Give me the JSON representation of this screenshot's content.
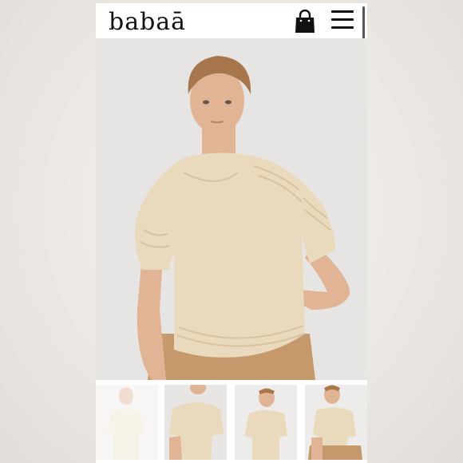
{
  "header": {
    "logo_text": "babaā",
    "bag_icon": "shopping-bag-icon",
    "menu_icon": "hamburger-menu-icon"
  },
  "hero": {
    "image_subject": "model-wearing-cream-knit-short-sleeve-sweater"
  },
  "thumbnails": [
    {
      "subject": "front-view",
      "active": false
    },
    {
      "subject": "detail-view",
      "active": false
    },
    {
      "subject": "side-view",
      "active": false
    },
    {
      "subject": "seated-view",
      "active": false
    }
  ],
  "colors": {
    "sweater": "#e9d9bd",
    "skirt": "#c6996c",
    "skin": "#e2b496",
    "hair": "#a8764c",
    "background": "#e6e5e3"
  }
}
